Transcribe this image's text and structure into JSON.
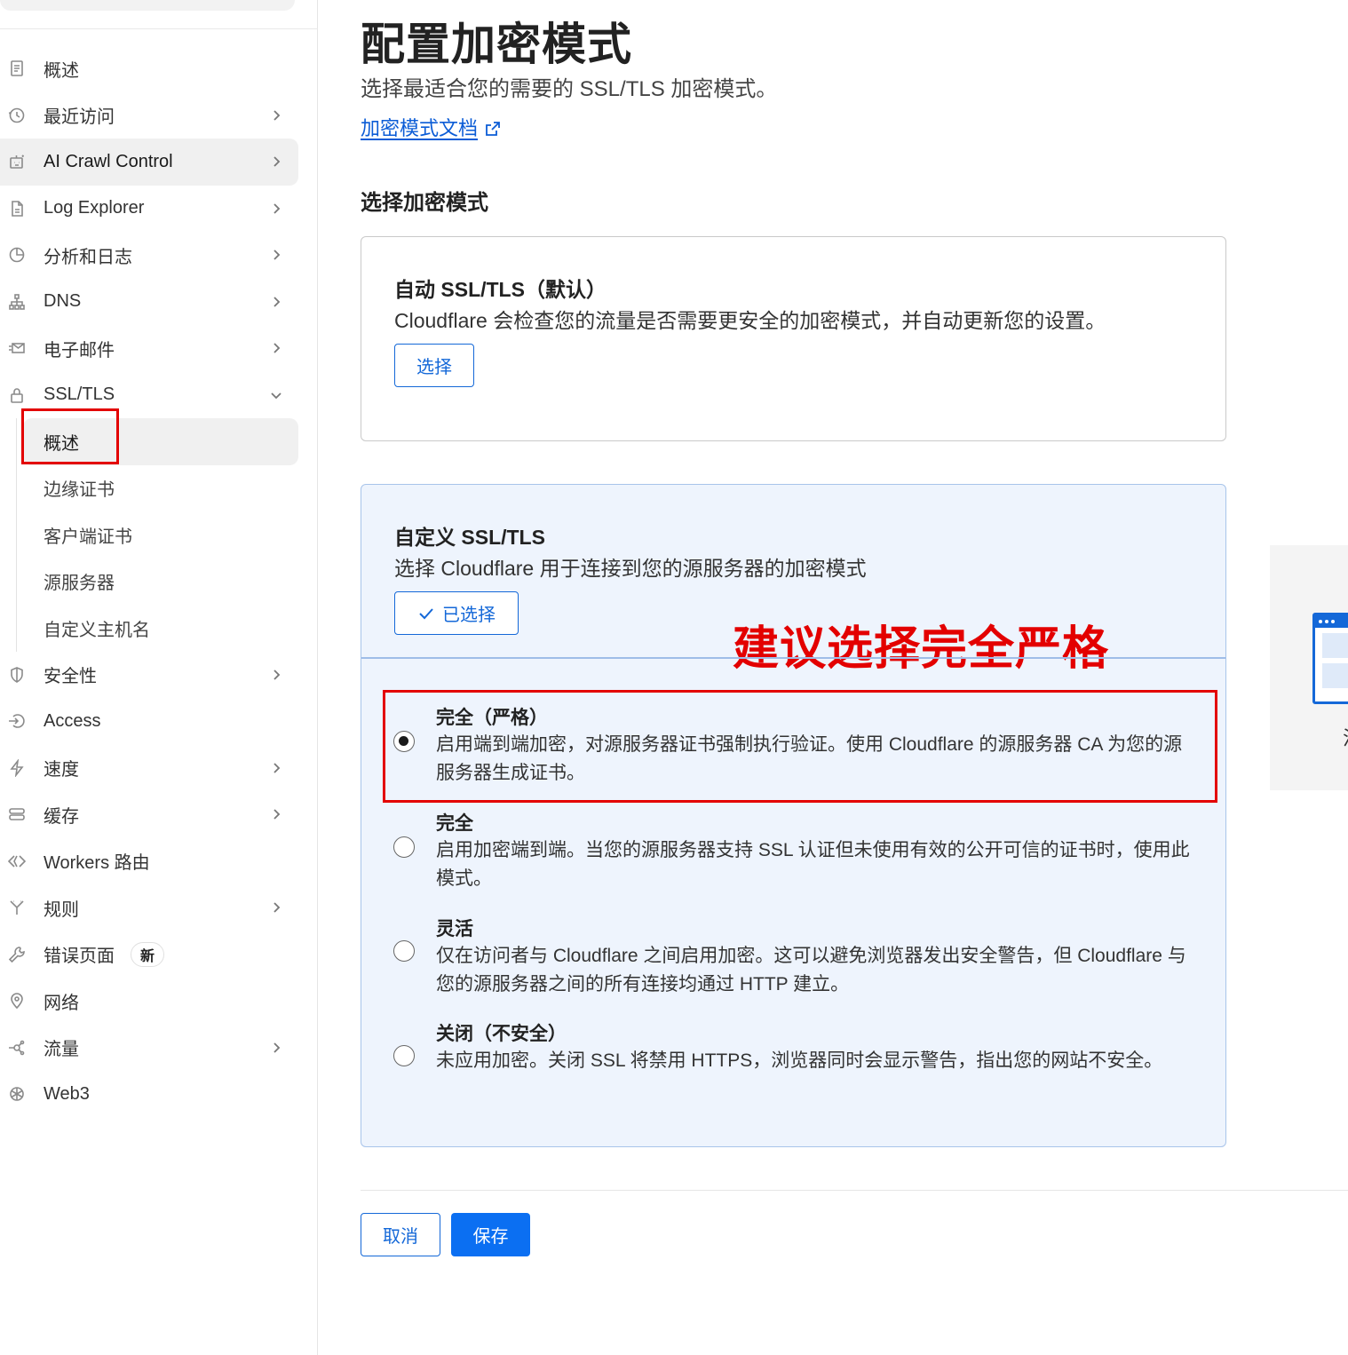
{
  "sidebar": {
    "items": [
      {
        "label": "概述",
        "icon": "document-icon",
        "chevron": false
      },
      {
        "label": "最近访问",
        "icon": "clock-icon",
        "chevron": true
      },
      {
        "label": "AI Crawl Control",
        "icon": "robot-icon",
        "chevron": true,
        "active": true
      },
      {
        "label": "Log Explorer",
        "icon": "log-icon",
        "chevron": true
      },
      {
        "label": "分析和日志",
        "icon": "pie-chart-icon",
        "chevron": true
      },
      {
        "label": "DNS",
        "icon": "network-tree-icon",
        "chevron": true
      },
      {
        "label": "电子邮件",
        "icon": "mail-icon",
        "chevron": true
      },
      {
        "label": "SSL/TLS",
        "icon": "lock-icon",
        "chevron": true,
        "expanded": true
      }
    ],
    "ssl_sub": [
      {
        "label": "概述",
        "active": true
      },
      {
        "label": "边缘证书"
      },
      {
        "label": "客户端证书"
      },
      {
        "label": "源服务器"
      },
      {
        "label": "自定义主机名"
      }
    ],
    "items2": [
      {
        "label": "安全性",
        "icon": "shield-icon",
        "chevron": true
      },
      {
        "label": "Access",
        "icon": "access-icon",
        "chevron": false
      },
      {
        "label": "速度",
        "icon": "lightning-icon",
        "chevron": true
      },
      {
        "label": "缓存",
        "icon": "storage-icon",
        "chevron": true
      },
      {
        "label": "Workers 路由",
        "icon": "code-icon",
        "chevron": false
      },
      {
        "label": "规则",
        "icon": "rules-icon",
        "chevron": true
      },
      {
        "label": "错误页面",
        "icon": "wrench-icon",
        "chevron": false,
        "badge": "新"
      },
      {
        "label": "网络",
        "icon": "location-pin-icon",
        "chevron": false
      },
      {
        "label": "流量",
        "icon": "traffic-icon",
        "chevron": true
      },
      {
        "label": "Web3",
        "icon": "web3-icon",
        "chevron": false
      }
    ]
  },
  "main": {
    "title": "配置加密模式",
    "subtitle": "选择最适合您的需要的 SSL/TLS 加密模式。",
    "doc_link": "加密模式文档",
    "section_title": "选择加密模式",
    "auto_card": {
      "title": "自动 SSL/TLS（默认）",
      "desc": "Cloudflare 会检查您的流量是否需要更安全的加密模式，并自动更新您的设置。",
      "button": "选择"
    },
    "custom_card": {
      "title": "自定义 SSL/TLS",
      "desc": "选择 Cloudflare 用于连接到您的源服务器的加密模式",
      "button": "已选择",
      "annotation": "建议选择完全严格",
      "options": [
        {
          "title": "完全（严格）",
          "desc": "启用端到端加密，对源服务器证书强制执行验证。使用 Cloudflare 的源服务器 CA 为您的源服务器生成证书。",
          "checked": true
        },
        {
          "title": "完全",
          "desc": "启用加密端到端。当您的源服务器支持 SSL 认证但未使用有效的公开可信的证书时，使用此模式。",
          "checked": false
        },
        {
          "title": "灵活",
          "desc": "仅在访问者与 Cloudflare 之间启用加密。这可以避免浏览器发出安全警告，但 Cloudflare 与您的源服务器之间的所有连接均通过 HTTP 建立。",
          "checked": false
        },
        {
          "title": "关闭（不安全）",
          "desc": "未应用加密。关闭 SSL 将禁用 HTTPS，浏览器同时会显示警告，指出您的网站不安全。",
          "checked": false
        }
      ]
    },
    "cancel_label": "取消",
    "save_label": "保存",
    "panel_fragment": "注"
  },
  "colors": {
    "accent": "#1468d8",
    "primary_button": "#0b6ff2",
    "annotation_red": "#e30000",
    "selected_card_bg": "#eef4fd"
  }
}
